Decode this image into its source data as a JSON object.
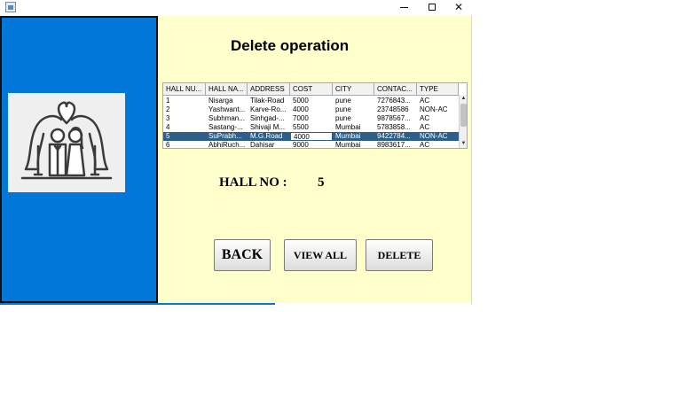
{
  "window": {
    "controls": {
      "minimize": "",
      "maximize": "",
      "close": "✕"
    }
  },
  "page": {
    "heading": "Delete operation",
    "hall_no_label": "HALL NO :",
    "hall_no_value": "5"
  },
  "table": {
    "columns": [
      "HALL NU...",
      "HALL NA...",
      "ADDRESS",
      "COST",
      "CITY",
      "CONTAC...",
      "TYPE"
    ],
    "rows": [
      [
        "1",
        "Nisarga",
        "Tilak-Road",
        "5000",
        "pune",
        "7276843...",
        "AC"
      ],
      [
        "2",
        "Yashwant...",
        "Karve-Ro...",
        "4000",
        "pune",
        "23748586",
        "NON-AC"
      ],
      [
        "3",
        "Subhman...",
        "Sinhgad-...",
        "7000",
        "pune",
        "9878567...",
        "AC"
      ],
      [
        "4",
        "Sastang-...",
        "Shivaji M...",
        "5500",
        "Mumbai",
        "5783858...",
        "AC"
      ],
      [
        "5",
        "SuPrabh...",
        "M.G.Road",
        "4000",
        "Mumbai",
        "9422784...",
        "NON-AC"
      ],
      [
        "6",
        "AbhiRuch...",
        "Dahisar",
        "9000",
        "Mumbai",
        "8983617...",
        "AC"
      ]
    ],
    "selected_row": 4
  },
  "buttons": {
    "back": "BACK",
    "view_all": "VIEW ALL",
    "delete": "DELETE"
  },
  "colors": {
    "left_panel": "#0077d9",
    "content_bg": "#ffffcc",
    "selection": "#2e5f8a"
  },
  "icons": [
    "app-java-icon",
    "wedding-couple-icon"
  ]
}
